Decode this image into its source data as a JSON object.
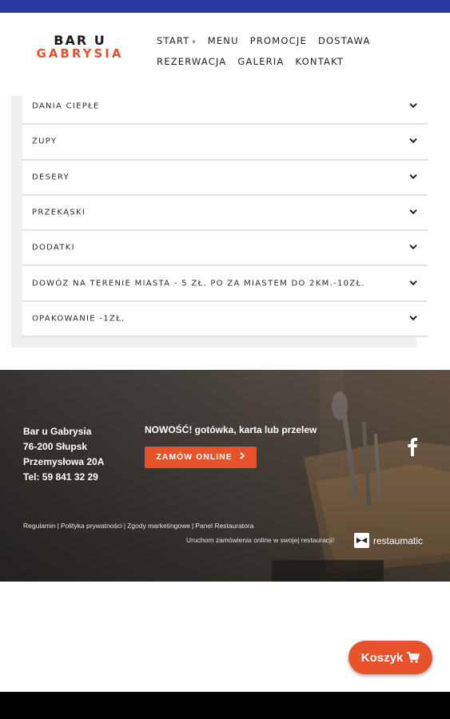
{
  "brand": {
    "line1": "BAR U",
    "line2": "GABRYSIA"
  },
  "nav": {
    "row1": [
      "START",
      "MENU",
      "PROMOCJE",
      "DOSTAWA"
    ],
    "row2": [
      "REZERWACJA",
      "GALERIA",
      "KONTAKT"
    ],
    "caret": "▾"
  },
  "menu_categories": [
    "DANIA CIEPŁE",
    "ZUPY",
    "DESERY",
    "PRZEKĄSKI",
    "DODATKI",
    "DOWÓZ NA TERENIE MIASTA - 5 ZŁ. PO ZA MIASTEM DO 2KM.-10ZŁ.",
    "OPAKOWANIE -1ZŁ."
  ],
  "footer": {
    "name": "Bar u Gabrysia",
    "postal": "76-200 Słupsk",
    "street": "Przemysłowa 20A",
    "phone": "Tel: 59 841 32 29",
    "news": "NOWOŚĆ! gotówka, karta lub przelew",
    "order_button": "ZAMÓW ONLINE",
    "links": [
      "Regulamin",
      "Polityka prywatności",
      "Zgody marketingowe",
      "Panel Restauratora"
    ],
    "powered_text": "Uruchom zamówienia online w swojej restauracji!",
    "powered_brand": "restaumatic"
  },
  "cart": {
    "label": "Koszyk"
  },
  "colors": {
    "accent": "#e8522a",
    "topbar": "#2b3a9e"
  },
  "icons": {
    "chevron": "chevron-down-icon",
    "facebook": "facebook-icon",
    "cart": "cart-icon"
  }
}
